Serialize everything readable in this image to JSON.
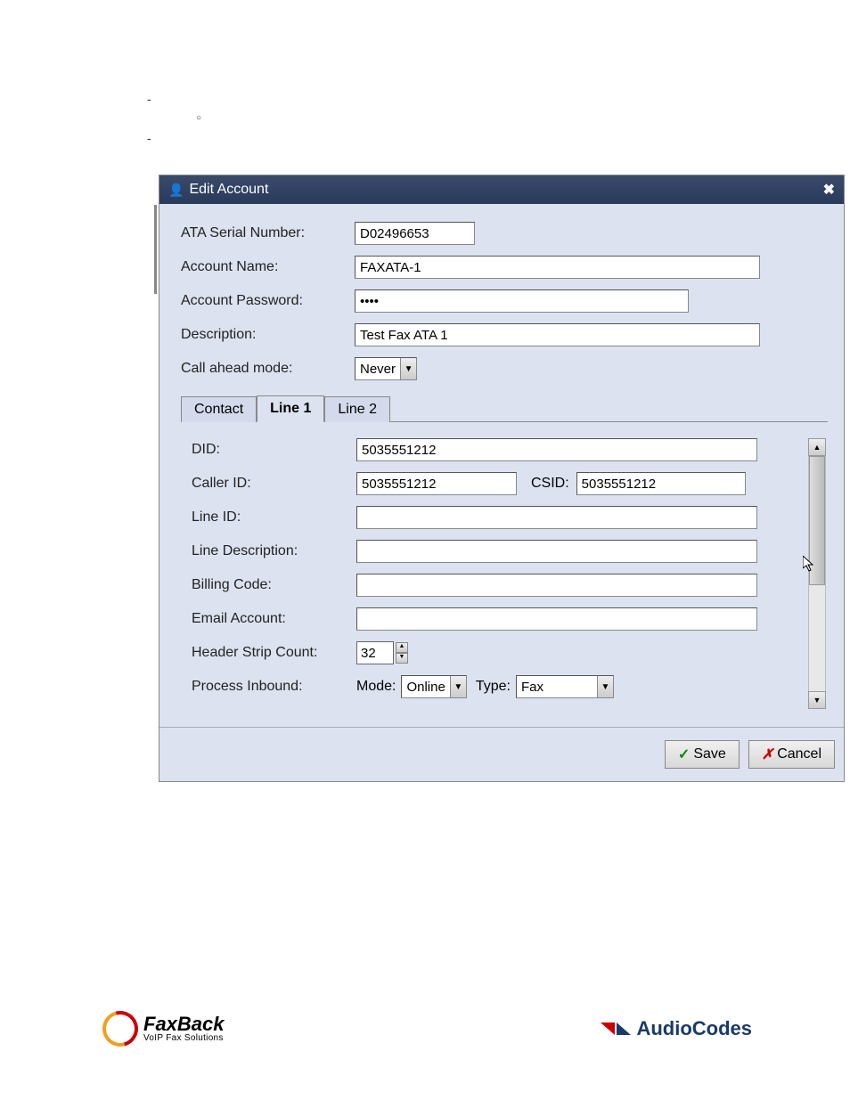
{
  "dialog": {
    "title": "Edit Account",
    "fields": {
      "ata_serial_label": "ATA Serial Number:",
      "ata_serial_value": "D02496653",
      "account_name_label": "Account Name:",
      "account_name_value": "FAXATA-1",
      "account_password_label": "Account Password:",
      "account_password_value": "••••",
      "description_label": "Description:",
      "description_value": "Test Fax ATA 1",
      "call_ahead_label": "Call ahead mode:",
      "call_ahead_value": "Never"
    },
    "tabs": {
      "contact": "Contact",
      "line1": "Line 1",
      "line2": "Line 2"
    },
    "line1": {
      "did_label": "DID:",
      "did_value": "5035551212",
      "callerid_label": "Caller ID:",
      "callerid_value": "5035551212",
      "csid_label": "CSID:",
      "csid_value": "5035551212",
      "lineid_label": "Line ID:",
      "lineid_value": "",
      "linedesc_label": "Line Description:",
      "linedesc_value": "",
      "billing_label": "Billing Code:",
      "billing_value": "",
      "email_label": "Email Account:",
      "email_value": "",
      "header_strip_label": "Header Strip Count:",
      "header_strip_value": "32",
      "process_label": "Process Inbound:",
      "mode_label": "Mode:",
      "mode_value": "Online",
      "type_label": "Type:",
      "type_value": "Fax"
    },
    "buttons": {
      "save": "Save",
      "cancel": "Cancel"
    }
  },
  "footer": {
    "faxback_main": "FaxBack",
    "faxback_sub": "VoIP Fax Solutions",
    "audiocodes": "AudioCodes"
  }
}
